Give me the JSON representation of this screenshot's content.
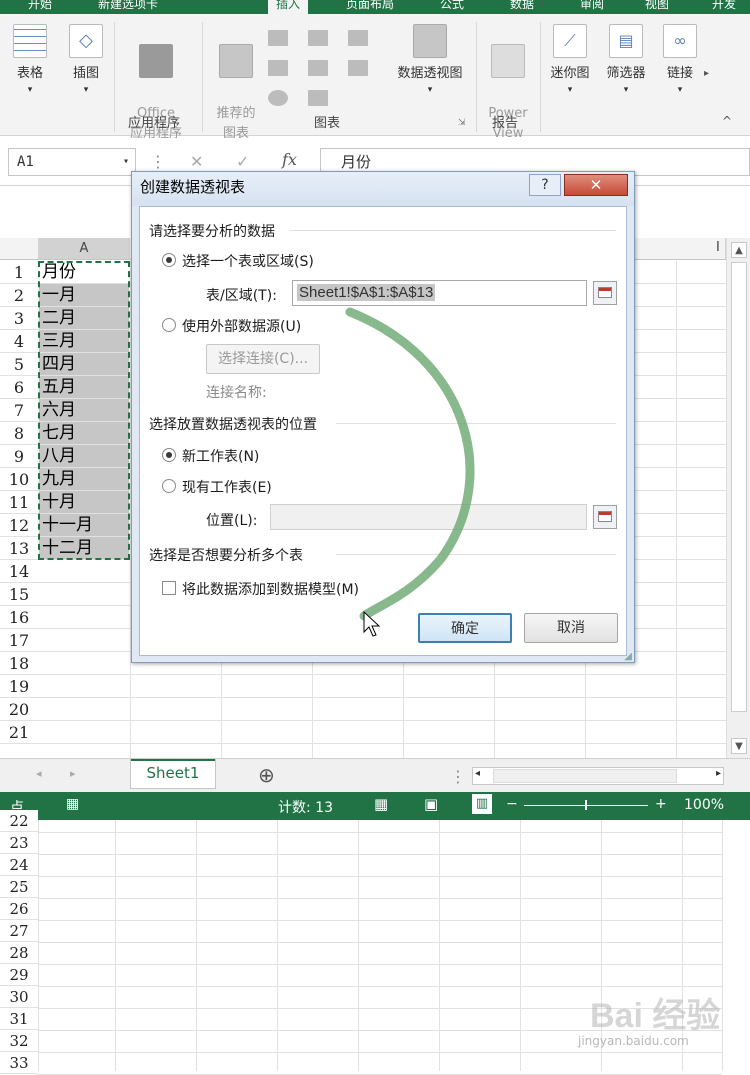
{
  "ribbon": {
    "tabs": [
      "开始",
      "新建选项卡",
      "插入",
      "页面布局",
      "公式",
      "数据",
      "审阅",
      "视图",
      "开发"
    ],
    "buttons": {
      "table": "表格",
      "illustration": "插图",
      "office_apps": "Office\n应用程序",
      "recommended_charts": "推荐的\n图表",
      "pivotchart": "数据透视图",
      "power_view": "Power\nView",
      "sparklines": "迷你图",
      "slicer": "筛选器",
      "link": "链接"
    },
    "groups": {
      "apps": "应用程序",
      "charts": "图表",
      "reports": "报告"
    }
  },
  "formula_bar": {
    "name_box": "A1",
    "fx": "fx",
    "content": "月份"
  },
  "sheet": {
    "col_a": "A",
    "col_right": "I",
    "rows": [
      "1",
      "2",
      "3",
      "4",
      "5",
      "6",
      "7",
      "8",
      "9",
      "10",
      "11",
      "12",
      "13",
      "14",
      "15",
      "16",
      "17",
      "18",
      "19",
      "20",
      "21"
    ],
    "cells": [
      "月份",
      "一月",
      "二月",
      "三月",
      "四月",
      "五月",
      "六月",
      "七月",
      "八月",
      "九月",
      "十月",
      "十一月",
      "十二月"
    ],
    "lower_rows": [
      "22",
      "23",
      "24",
      "25",
      "26",
      "27",
      "28",
      "29",
      "30",
      "31",
      "32",
      "33"
    ]
  },
  "sheet_tabs": {
    "active": "Sheet1",
    "add": "⊕"
  },
  "status_bar": {
    "mode": "点",
    "count": "计数: 13",
    "zoom": "100%"
  },
  "dialog": {
    "title": "创建数据透视表",
    "help": "?",
    "close": "✕",
    "section1": "请选择要分析的数据",
    "opt_range": "选择一个表或区域(S)",
    "range_label": "表/区域(T):",
    "range_value": "Sheet1!$A$1:$A$13",
    "opt_external": "使用外部数据源(U)",
    "choose_conn": "选择连接(C)...",
    "conn_name": "连接名称:",
    "section2": "选择放置数据透视表的位置",
    "opt_new": "新工作表(N)",
    "opt_existing": "现有工作表(E)",
    "location_label": "位置(L):",
    "location_value": "",
    "section3": "选择是否想要分析多个表",
    "add_model": "将此数据添加到数据模型(M)",
    "ok": "确定",
    "cancel": "取消"
  },
  "watermark": {
    "brand": "Bai 经验",
    "url": "jingyan.baidu.com"
  },
  "colors": {
    "excel_green": "#217346",
    "selection_gray": "#c6c6c6",
    "stroke_green": "#6aa86f"
  }
}
